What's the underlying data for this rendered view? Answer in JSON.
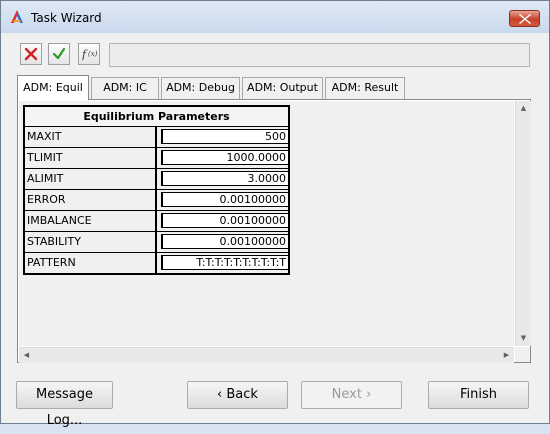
{
  "window": {
    "title": "Task Wizard",
    "close_icon": "close-icon"
  },
  "toolbar": {
    "icons": [
      "cancel-x-icon",
      "accept-check-icon",
      "function-icon"
    ],
    "formula_value": ""
  },
  "tabs": [
    {
      "label": "ADM: Equil",
      "active": true
    },
    {
      "label": "ADM: IC",
      "active": false
    },
    {
      "label": "ADM: Debug",
      "active": false
    },
    {
      "label": "ADM: Output",
      "active": false
    },
    {
      "label": "ADM: Result",
      "active": false
    }
  ],
  "params": {
    "title": "Equilibrium Parameters",
    "rows": [
      {
        "name": "MAXIT",
        "value": "500"
      },
      {
        "name": "TLIMIT",
        "value": "1000.0000"
      },
      {
        "name": "ALIMIT",
        "value": "3.0000"
      },
      {
        "name": "ERROR",
        "value": "0.00100000"
      },
      {
        "name": "IMBALANCE",
        "value": "0.00100000"
      },
      {
        "name": "STABILITY",
        "value": "0.00100000"
      },
      {
        "name": "PATTERN",
        "value": "T:T:T:T:T:T:T:T:T:T"
      }
    ]
  },
  "buttons": {
    "message_log": "Message Log...",
    "back": "Back",
    "next": "Next",
    "finish": "Finish"
  },
  "colors": {
    "cancel": "#d42020",
    "accept": "#2a9a2a",
    "close": "#c7402a"
  }
}
